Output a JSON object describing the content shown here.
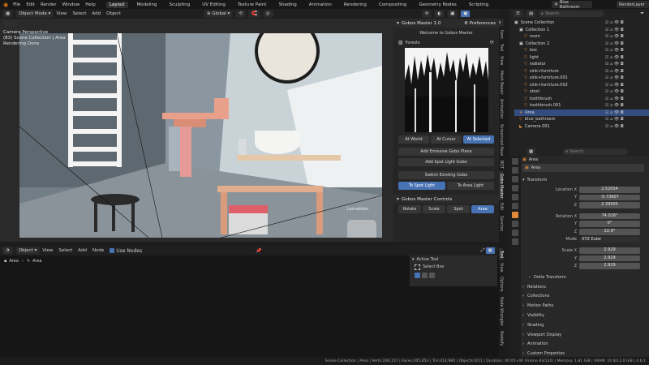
{
  "topbar": {
    "menus": [
      "File",
      "Edit",
      "Render",
      "Window",
      "Help"
    ],
    "workspaces": [
      "Layout",
      "Modeling",
      "Sculpting",
      "UV Editing",
      "Texture Paint",
      "Shading",
      "Animation",
      "Rendering",
      "Compositing",
      "Geometry Nodes",
      "Scripting"
    ],
    "scene_name": "Blue Bathroom",
    "view_layer": "RenderLayer"
  },
  "viewport": {
    "mode": "Object Mode",
    "menus": [
      "View",
      "Select",
      "Add",
      "Object"
    ],
    "transform_orientation": "Global",
    "options_label": "Options",
    "overlay_lines": [
      "Camera Perspective",
      "(83) Scene Collection | Area",
      "Rendering Done"
    ],
    "watermark": "Lernaktion"
  },
  "gobos": {
    "header_title": "Gobos Master 1.0",
    "preferences_label": "Preferences",
    "welcome": "Welcome to Gobos Master",
    "selected_gobo": "Forests",
    "place_buttons": [
      "At World",
      "At Cursor",
      "At Selected"
    ],
    "add_emissive": "Add Emissive Gobo Plane",
    "add_spot": "Add Spot Light Gobo",
    "switch_existing": "Switch Existing Gobo",
    "switch_buttons": [
      "To Spot Light",
      "To Area Light"
    ],
    "controls_title": "Gobos Master Controls",
    "control_labels": [
      "Rotate",
      "Scale",
      "Spot",
      "Area"
    ]
  },
  "side_tabs": [
    "Item",
    "Tool",
    "View",
    "Mesh Repair",
    "Animation",
    "Screencast Keys",
    "BQT",
    "Gobo Master",
    "Edit",
    "Sanctus"
  ],
  "node_side_tabs": [
    "Tool",
    "View",
    "Options",
    "Node Wrangler",
    "Nodeify"
  ],
  "outliner": {
    "search_placeholder": "Search",
    "items": [
      {
        "label": "Scene Collection",
        "depth": 0,
        "kind": "collection"
      },
      {
        "label": "Collection 1",
        "depth": 1,
        "kind": "collection"
      },
      {
        "label": "room",
        "depth": 2,
        "kind": "mesh"
      },
      {
        "label": "Collection 2",
        "depth": 1,
        "kind": "collection"
      },
      {
        "label": "box",
        "depth": 2,
        "kind": "mesh"
      },
      {
        "label": "light",
        "depth": 2,
        "kind": "mesh"
      },
      {
        "label": "radiator",
        "depth": 2,
        "kind": "mesh"
      },
      {
        "label": "sink+furniture",
        "depth": 2,
        "kind": "mesh"
      },
      {
        "label": "sink+furniture.001",
        "depth": 2,
        "kind": "mesh"
      },
      {
        "label": "sink+furniture.002",
        "depth": 2,
        "kind": "mesh"
      },
      {
        "label": "stool",
        "depth": 2,
        "kind": "mesh"
      },
      {
        "label": "toothbrush",
        "depth": 2,
        "kind": "mesh"
      },
      {
        "label": "toothbrush.001",
        "depth": 2,
        "kind": "mesh"
      },
      {
        "label": "Area",
        "depth": 1,
        "kind": "light"
      },
      {
        "label": "blue_bathroom",
        "depth": 1,
        "kind": "mesh"
      },
      {
        "label": "Camera.001",
        "depth": 1,
        "kind": "camera"
      }
    ]
  },
  "properties": {
    "search_placeholder": "Search",
    "breadcrumb": "Area",
    "object_name": "Area",
    "transform_title": "Transform",
    "location": {
      "label": "Location X",
      "x": "2.52054",
      "y": "-5.73907",
      "z": "2.39505"
    },
    "rotation": {
      "label": "Rotation X",
      "x": "74.016°",
      "y": "0°",
      "z": "22.9°"
    },
    "mode_label": "Mode",
    "mode_value": "XYZ Euler",
    "scale": {
      "label": "Scale X",
      "x": "2.929",
      "y": "2.929",
      "z": "2.929"
    },
    "axis_y": "Y",
    "axis_z": "Z",
    "sections": [
      "Delta Transform",
      "Relations",
      "Collections",
      "Motion Paths",
      "Visibility",
      "Shading",
      "Viewport Display",
      "Animation",
      "Custom Properties"
    ]
  },
  "node_editor": {
    "mode": "Object",
    "menus": [
      "View",
      "Select",
      "Add",
      "Node"
    ],
    "use_nodes": "Use Nodes",
    "breadcrumb_a": "Area",
    "breadcrumb_b": "Area",
    "active_tool_title": "Active Tool",
    "select_box": "Select Box"
  },
  "status": "Scene Collection | Area | Verts:206,157 | Faces:205,853 | Tris:414,980 | Objects:0/11 | Duration: 00:05+00 (Frame 83/120) | Memory: 1.81 GiB | VRAM: 10.8/12.0 GiB | 4.6.1"
}
